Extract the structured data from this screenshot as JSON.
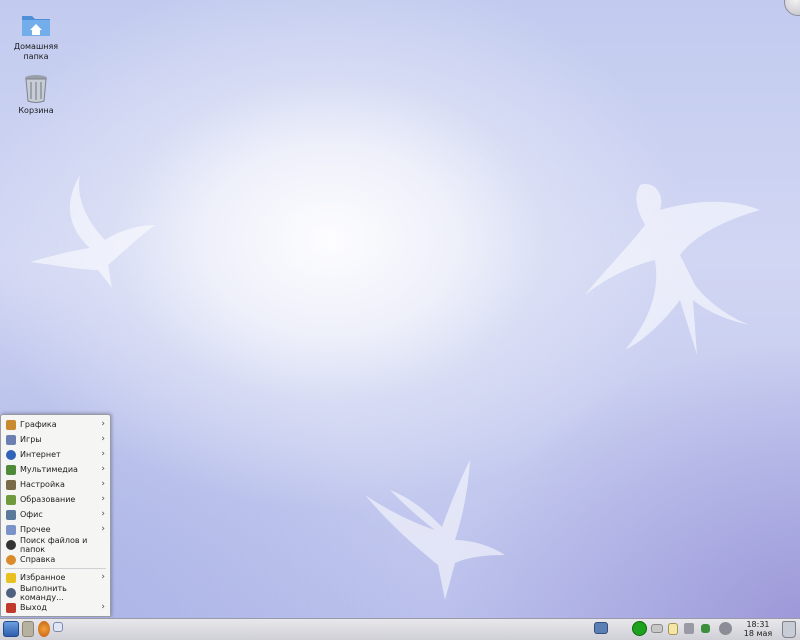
{
  "desktop": {
    "icons": [
      {
        "label": "Домашняя\nпапка",
        "icon": "home-folder-icon"
      },
      {
        "label": "Корзина",
        "icon": "trash-icon"
      }
    ]
  },
  "start_menu": {
    "items": [
      {
        "label": "Графика",
        "icon": "graphics-icon",
        "submenu": true,
        "color": "#c9892f"
      },
      {
        "label": "Игры",
        "icon": "games-icon",
        "submenu": true,
        "color": "#6b7fb3"
      },
      {
        "label": "Интернет",
        "icon": "globe-icon",
        "submenu": true,
        "color": "#2f62b8"
      },
      {
        "label": "Мультимедиа",
        "icon": "multimedia-icon",
        "submenu": true,
        "color": "#4f8a3a"
      },
      {
        "label": "Настройка",
        "icon": "settings-icon",
        "submenu": true,
        "color": "#7a6a4a"
      },
      {
        "label": "Образование",
        "icon": "education-icon",
        "submenu": true,
        "color": "#6f9b3c"
      },
      {
        "label": "Офис",
        "icon": "office-icon",
        "submenu": true,
        "color": "#5b7a9a"
      },
      {
        "label": "Прочее",
        "icon": "misc-icon",
        "submenu": true,
        "color": "#7c93c9"
      },
      {
        "label": "Поиск файлов и папок",
        "icon": "binoculars-icon",
        "submenu": false,
        "color": "#333333"
      },
      {
        "label": "Справка",
        "icon": "help-lifebuoy-icon",
        "submenu": false,
        "color": "#d98a2b"
      }
    ],
    "bottom_items": [
      {
        "label": "Избранное",
        "icon": "star-icon",
        "submenu": true,
        "color": "#e8c020"
      },
      {
        "label": "Выполнить команду...",
        "icon": "run-command-icon",
        "submenu": false,
        "color": "#506080"
      },
      {
        "label": "Выход",
        "icon": "logout-icon",
        "submenu": true,
        "color": "#c0392b"
      }
    ]
  },
  "taskbar": {
    "clock_time": "18:31",
    "clock_date": "18 мая"
  }
}
